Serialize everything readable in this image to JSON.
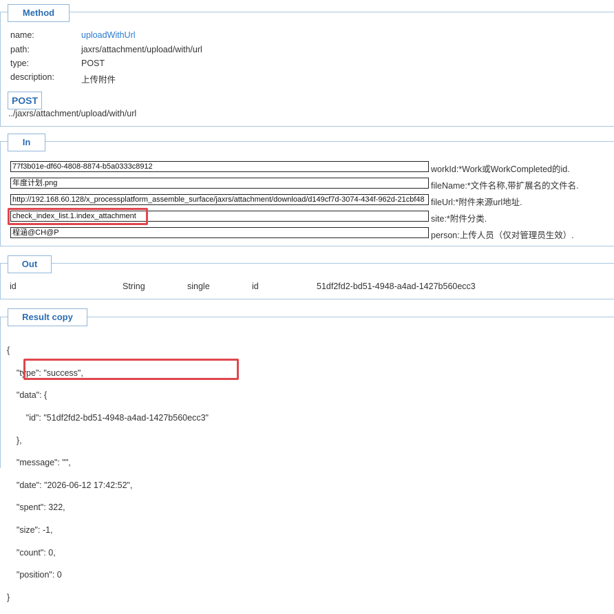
{
  "method": {
    "legend": "Method",
    "name_label": "name:",
    "name_value": "uploadWithUrl",
    "path_label": "path:",
    "path_value": "jaxrs/attachment/upload/with/url",
    "type_label": "type:",
    "type_value": "POST",
    "description_label": "description:",
    "description_value": "上传附件",
    "post_button": "POST",
    "url": "../jaxrs/attachment/upload/with/url"
  },
  "in": {
    "legend": "In",
    "fields": [
      {
        "value": "77f3b01e-df60-4808-8874-b5a0333c8912",
        "desc": "workId:*Work或WorkCompleted的id."
      },
      {
        "value": "年度计划.png",
        "desc": "fileName:*文件名称,带扩展名的文件名."
      },
      {
        "value": "http://192.168.60.128/x_processplatform_assemble_surface/jaxrs/attachment/download/d149cf7d-3074-434f-962d-21cbf48",
        "desc": "fileUrl:*附件来源url地址."
      },
      {
        "value": "check_index_list.1.index_attachment",
        "desc": "site:*附件分类."
      },
      {
        "value": "程涵@CH@P",
        "desc": "person:上传人员（仅对管理员生效）."
      }
    ]
  },
  "out": {
    "legend": "Out",
    "row": {
      "name": "id",
      "type": "String",
      "multiplicity": "single",
      "desc": "id",
      "value": "51df2fd2-bd51-4948-a4ad-1427b560ecc3"
    }
  },
  "result": {
    "legend": "Result copy",
    "lines": [
      "{",
      "    \"type\": \"success\",",
      "    \"data\": {",
      "        \"id\": \"51df2fd2-bd51-4948-a4ad-1427b560ecc3\"",
      "    },",
      "    \"message\": \"\",",
      "    \"date\": \"2026-06-12 17:42:52\",",
      "    \"spent\": 322,",
      "    \"size\": -1,",
      "    \"count\": 0,",
      "    \"position\": 0",
      "}"
    ]
  },
  "colors": {
    "accent": "#2b6db3",
    "border": "#a9c6e0",
    "highlight": "#e0464d"
  }
}
